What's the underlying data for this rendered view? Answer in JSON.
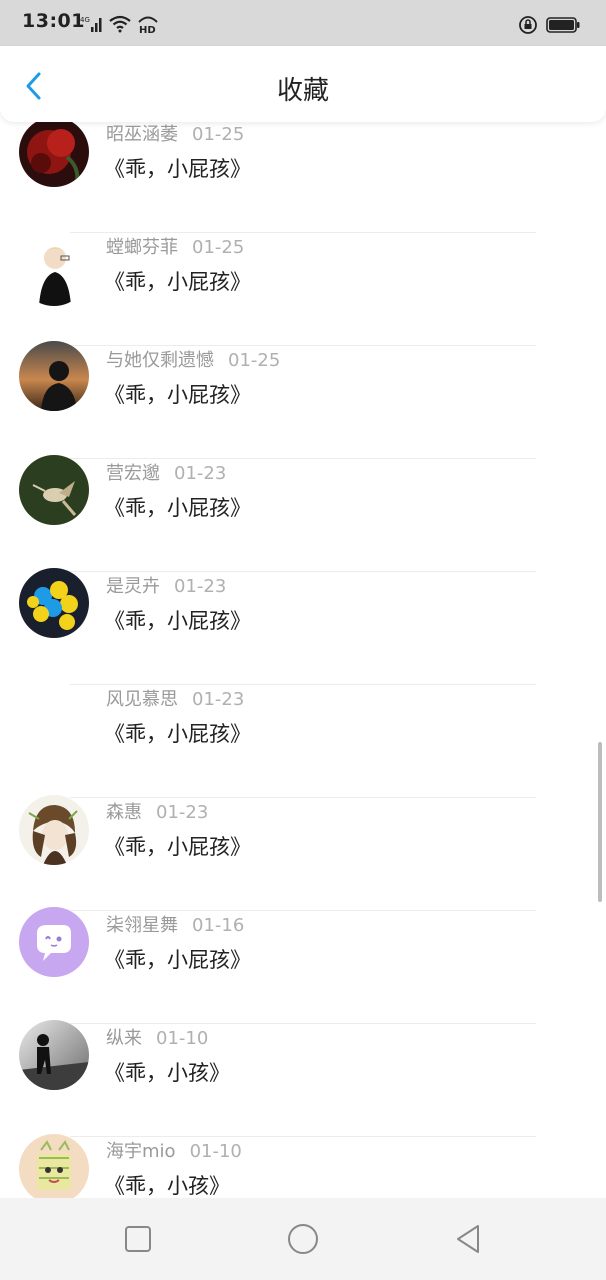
{
  "status": {
    "time": "13:01",
    "net": "4G",
    "hd": "HD"
  },
  "header": {
    "title": "收藏"
  },
  "items": [
    {
      "user": "昭巫涵萎",
      "date": "01-25",
      "title": "《乖，小屁孩》",
      "avatar": "red-flower-avatar"
    },
    {
      "user": "螳螂芬菲",
      "date": "01-25",
      "title": "《乖，小屁孩》",
      "avatar": "anime-boy-avatar"
    },
    {
      "user": "与她仅剩遗憾",
      "date": "01-25",
      "title": "《乖，小屁孩》",
      "avatar": "sunset-silhouette-avatar"
    },
    {
      "user": "营宏邈",
      "date": "01-23",
      "title": "《乖，小屁孩》",
      "avatar": "hummingbird-avatar"
    },
    {
      "user": "是灵卉",
      "date": "01-23",
      "title": "《乖，小屁孩》",
      "avatar": "balloons-avatar"
    },
    {
      "user": "风见慕思",
      "date": "01-23",
      "title": "《乖，小屁孩》",
      "avatar": ""
    },
    {
      "user": "森惠",
      "date": "01-23",
      "title": "《乖，小屁孩》",
      "avatar": "anime-girl-avatar"
    },
    {
      "user": "柒翎星舞",
      "date": "01-16",
      "title": "《乖，小屁孩》",
      "avatar": "chat-bubble-avatar"
    },
    {
      "user": "纵来",
      "date": "01-10",
      "title": "《乖，小孩》",
      "avatar": "bw-figure-avatar"
    },
    {
      "user": "海宇mio",
      "date": "01-10",
      "title": "《乖，小孩》",
      "avatar": "cartoon-avatar"
    }
  ],
  "colors": {
    "accent": "#1e9be6",
    "statusbar": "#d9d9d9",
    "bottombar": "#f3f3f3"
  },
  "icons": {
    "back": "chevron-left-icon",
    "home": "circle-icon",
    "recent": "square-icon",
    "nav_back": "triangle-left-icon"
  }
}
